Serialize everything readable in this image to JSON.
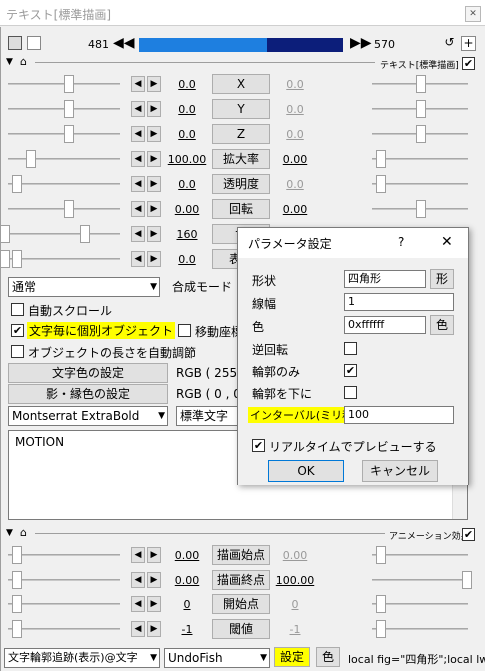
{
  "window": {
    "title": "テキスト[標準描画]",
    "close": "✕"
  },
  "seek": {
    "start": "481",
    "end": "570",
    "position_fraction": 0.62
  },
  "section": {
    "text_label": "テキスト[標準描画]",
    "anim_label": "アニメーション効果"
  },
  "params": [
    {
      "left": "0.0",
      "btn": "X",
      "right": "0.0"
    },
    {
      "left": "0.0",
      "btn": "Y",
      "right": "0.0"
    },
    {
      "left": "0.0",
      "btn": "Z",
      "right": "0.0"
    },
    {
      "left": "100.00",
      "btn": "拡大率",
      "right": "0.00"
    },
    {
      "left": "0.0",
      "btn": "透明度",
      "right": "0.0"
    },
    {
      "left": "0.00",
      "btn": "回転",
      "right": "0.00"
    },
    {
      "left": "160",
      "btn": "サ",
      "right": ""
    },
    {
      "left": "0.0",
      "btn": "表示",
      "right": ""
    }
  ],
  "blend": {
    "value": "通常",
    "label": "合成モード"
  },
  "checks": {
    "autoscroll": "自動スクロール",
    "individual": "文字毎に個別オブジェクト",
    "move_coord": "移動座標",
    "auto_length": "オブジェクトの長さを自動調節"
  },
  "color_btn": {
    "text_color": "文字色の設定",
    "shadow_color": "影・縁色の設定",
    "rgb1": "RGB ( 255 ,",
    "rgb2": "RGB ( 0 , 0 ,"
  },
  "font": {
    "name": "Montserrat ExtraBold",
    "style": "標準文字"
  },
  "textarea": "MOTION",
  "anim": [
    {
      "left": "0.00",
      "btn": "描画始点",
      "right": "0.00"
    },
    {
      "left": "0.00",
      "btn": "描画終点",
      "right": "100.00"
    },
    {
      "left": "0",
      "btn": "開始点",
      "right": "0"
    },
    {
      "left": "-1",
      "btn": "閾値",
      "right": "-1"
    }
  ],
  "bottom": {
    "effect": "文字輪郭追跡(表示)@文字",
    "script": "UndoFish",
    "settings": "設定",
    "color": "色",
    "code": "local fig=\"四角形\";local lw"
  },
  "dialog": {
    "title": "パラメータ設定",
    "help": "?",
    "close": "✕",
    "shape_label": "形状",
    "shape_value": "四角形",
    "shape_btn": "形",
    "line_label": "線幅",
    "line_value": "1",
    "color_label": "色",
    "color_value": "0xffffff",
    "color_btn": "色",
    "reverse_label": "逆回転",
    "outline_label": "輪郭のみ",
    "under_label": "輪郭を下に",
    "interval_label": "インターバル(ミリ秒)",
    "interval_value": "100",
    "preview_label": "リアルタイムでプレビューする",
    "ok": "OK",
    "cancel": "キャンセル"
  }
}
